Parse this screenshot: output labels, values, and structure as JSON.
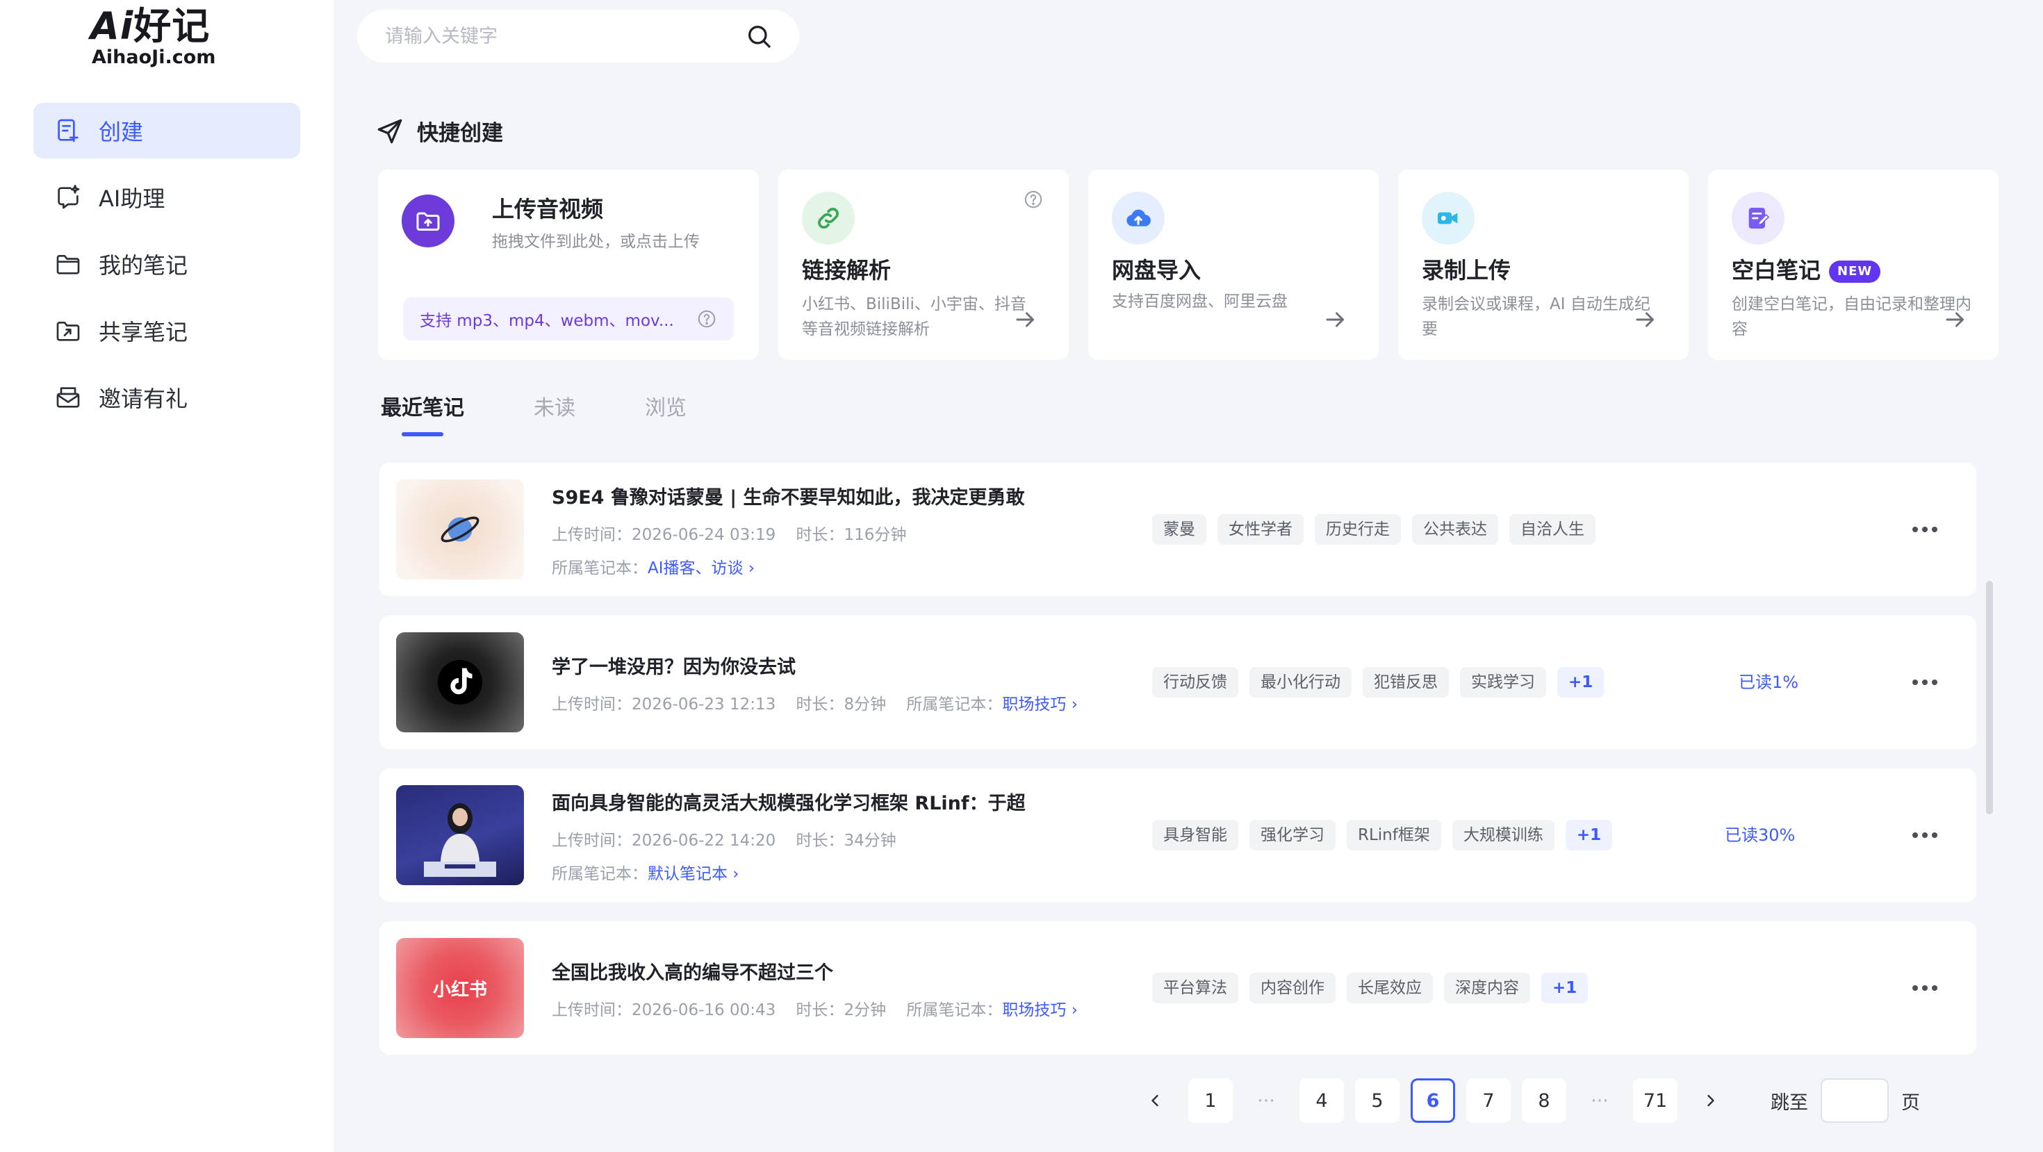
{
  "brand": {
    "ai": "Ai",
    "name": "好记",
    "domain": "AihaoJi.com"
  },
  "nav": [
    {
      "label": "创建",
      "icon": "create-note-icon",
      "active": true
    },
    {
      "label": "AI助理",
      "icon": "ai-chat-icon",
      "active": false
    },
    {
      "label": "我的笔记",
      "icon": "folder-icon",
      "active": false
    },
    {
      "label": "共享笔记",
      "icon": "share-folder-icon",
      "active": false
    },
    {
      "label": "邀请有礼",
      "icon": "invite-mail-icon",
      "active": false
    }
  ],
  "search": {
    "placeholder": "请输入关键字"
  },
  "quick_create": {
    "title": "快捷创建",
    "upload": {
      "title": "上传音视频",
      "desc": "拖拽文件到此处，或点击上传",
      "support": "支持 mp3、mp4、webm、mov..."
    },
    "link": {
      "title": "链接解析",
      "desc": "小红书、BiliBili、小宇宙、抖音等音视频链接解析"
    },
    "cloud": {
      "title": "网盘导入",
      "desc": "支持百度网盘、阿里云盘"
    },
    "record": {
      "title": "录制上传",
      "desc": "录制会议或课程，AI 自动生成纪要"
    },
    "blank": {
      "title": "空白笔记",
      "badge": "NEW",
      "desc": "创建空白笔记，自由记录和整理内容"
    }
  },
  "tabs": [
    "最近笔记",
    "未读",
    "浏览"
  ],
  "notes": [
    {
      "title": "S9E4 鲁豫对话蒙曼 | 生命不要早知如此，我决定更勇敢",
      "upload_label": "上传时间：",
      "upload_time": "2026-06-24 03:19",
      "duration_label": "时长：",
      "duration": "116分钟",
      "notebook_label": "所属笔记本：",
      "notebook": "AI播客、访谈",
      "tags": [
        "蒙曼",
        "女性学者",
        "历史行走",
        "公共表达",
        "自洽人生"
      ],
      "more_tags": "",
      "read": ""
    },
    {
      "title": "学了一堆没用？因为你没去试",
      "upload_label": "上传时间：",
      "upload_time": "2026-06-23 12:13",
      "duration_label": "时长：",
      "duration": "8分钟",
      "notebook_label": "所属笔记本：",
      "notebook": "职场技巧",
      "tags": [
        "行动反馈",
        "最小化行动",
        "犯错反思",
        "实践学习"
      ],
      "more_tags": "+1",
      "read": "已读1%"
    },
    {
      "title": "面向具身智能的高灵活大规模强化学习框架 RLinf：于超",
      "upload_label": "上传时间：",
      "upload_time": "2026-06-22 14:20",
      "duration_label": "时长：",
      "duration": "34分钟",
      "notebook_label": "所属笔记本：",
      "notebook": "默认笔记本",
      "tags": [
        "具身智能",
        "强化学习",
        "RLinf框架",
        "大规模训练"
      ],
      "more_tags": "+1",
      "read": "已读30%"
    },
    {
      "title": "全国比我收入高的编导不超过三个",
      "upload_label": "上传时间：",
      "upload_time": "2026-06-16 00:43",
      "duration_label": "时长：",
      "duration": "2分钟",
      "notebook_label": "所属笔记本：",
      "notebook": "职场技巧",
      "thumb_text": "小红书",
      "tags": [
        "平台算法",
        "内容创作",
        "长尾效应",
        "深度内容"
      ],
      "more_tags": "+1",
      "read": ""
    }
  ],
  "pagination": {
    "pages": [
      "1",
      "4",
      "5",
      "6",
      "7",
      "8",
      "71"
    ],
    "current": "6",
    "ellipsis": "···",
    "jump_label": "跳至",
    "page_suffix": "页"
  },
  "colors": {
    "accent": "#3d5afe",
    "purple": "#6c3bd9",
    "green": "#3aa757",
    "blue": "#3d7bf5",
    "cyan": "#2fb6e9",
    "violet": "#7a5cf0"
  }
}
